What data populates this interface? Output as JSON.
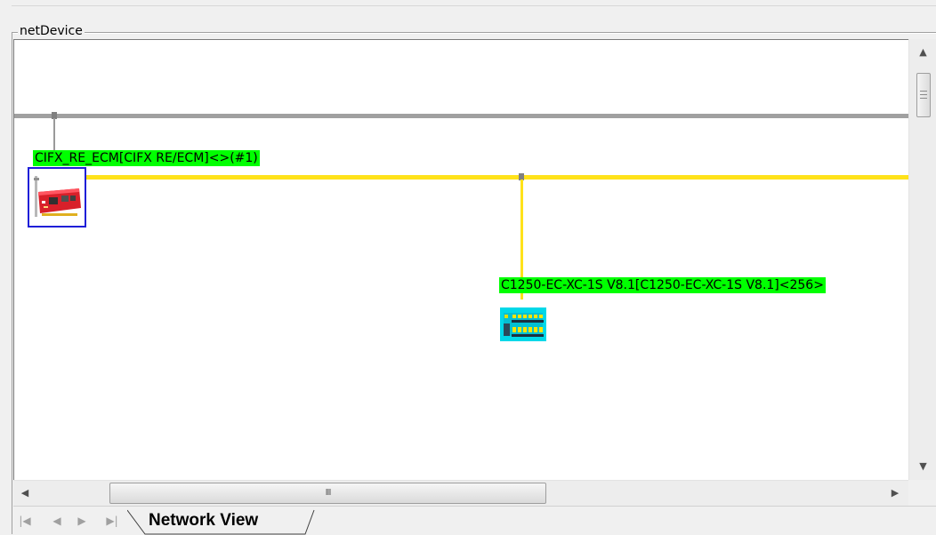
{
  "groupbox": {
    "title": "netDevice"
  },
  "network": {
    "master": {
      "label": "CIFX_RE_ECM[CIFX RE/ECM]<>(#1)",
      "icon": "pci-card-icon",
      "selected": true
    },
    "slave": {
      "label": "C1250-EC-XC-1S V8.1[C1250-EC-XC-1S V8.1]<256>",
      "icon": "io-module-icon"
    },
    "colors": {
      "main_bus": "#a0a0a0",
      "ethercat_bus": "#ffe21a",
      "label_background": "#00ff00",
      "selection_border": "#1f1fd8"
    }
  },
  "scrollbars": {
    "vertical_thumb_glyph": "≡",
    "horizontal_thumb_glyph": "III"
  },
  "tabs": {
    "nav_first": "|◀",
    "nav_prev": "◀",
    "nav_next": "▶",
    "nav_last": "▶|",
    "active_label": "Network View"
  }
}
